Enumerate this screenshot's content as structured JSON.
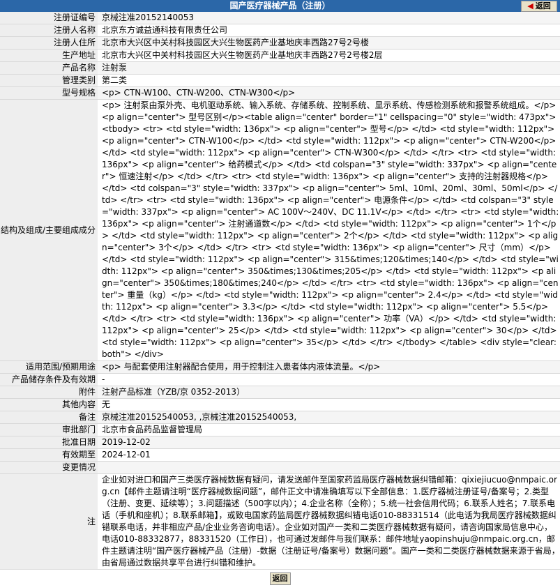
{
  "header": {
    "title": "国产医疗器械产品（注册）",
    "back_label": "返回"
  },
  "rows": [
    {
      "label": "注册证编号",
      "value": "京械注准20152140053"
    },
    {
      "label": "注册人名称",
      "value": "北京东方诚益通科技有限责任公司"
    },
    {
      "label": "注册人住所",
      "value": "北京市大兴区中关村科技园区大兴生物医药产业基地庆丰西路27号2号楼"
    },
    {
      "label": "生产地址",
      "value": "北京市大兴区中关村科技园区大兴生物医药产业基地庆丰西路27号2号楼2层"
    },
    {
      "label": "产品名称",
      "value": "注射泵"
    },
    {
      "label": "管理类别",
      "value": "第二类"
    },
    {
      "label": "型号规格",
      "value": "<p> CTN-W100、CTN-W200、CTN-W300</p>"
    },
    {
      "label": "结构及组成/主要组成成分",
      "value": "<p> 注射泵由泵外壳、电机驱动系统、输入系统、存储系统、控制系统、显示系统、传感检测系统和报警系统组成。</p> <p align=\"center\"> 型号区别</p><table align=\"center\" border=\"1\" cellspacing=\"0\" style=\"width: 473px\"> <tbody> <tr> <td style=\"width: 136px\"> <p align=\"center\"> 型号</p> </td> <td style=\"width: 112px\"> <p align=\"center\"> CTN-W100</p> </td> <td style=\"width: 112px\"> <p align=\"center\"> CTN-W200</p> </td> <td style=\"width: 112px\"> <p align=\"center\"> CTN-W300</p> </td> </tr> <tr> <td style=\"width: 136px\"> <p align=\"center\"> 给药模式</p> </td> <td colspan=\"3\" style=\"width: 337px\"> <p align=\"center\"> 恒速注射</p> </td> </tr> <tr> <td style=\"width: 136px\"> <p align=\"center\"> 支持的注射器规格</p> </td> <td colspan=\"3\" style=\"width: 337px\"> <p align=\"center\"> 5ml、10ml、20ml、30ml、50ml</p> </td> </tr> <tr> <td style=\"width: 136px\"> <p align=\"center\"> 电源条件</p> </td> <td colspan=\"3\" style=\"width: 337px\"> <p align=\"center\"> AC 100V～240V、DC 11.1V</p> </td> </tr> <tr> <td style=\"width: 136px\"> <p align=\"center\"> 注射通道数</p> </td> <td style=\"width: 112px\"> <p align=\"center\"> 1个</p> </td> <td style=\"width: 112px\"> <p align=\"center\"> 2个</p> </td> <td style=\"width: 112px\"> <p align=\"center\"> 3个</p> </td> </tr> <tr> <td style=\"width: 136px\"> <p align=\"center\"> 尺寸（mm）</p> </td> <td style=\"width: 112px\"> <p align=\"center\"> 315&times;120&times;140</p> </td> <td style=\"width: 112px\"> <p align=\"center\"> 350&times;130&times;205</p> </td> <td style=\"width: 112px\"> <p align=\"center\"> 350&times;180&times;240</p> </td> </tr> <tr> <td style=\"width: 136px\"> <p align=\"center\"> 重量（kg）</p> </td> <td style=\"width: 112px\"> <p align=\"center\"> 2.4</p> </td> <td style=\"width: 112px\"> <p align=\"center\"> 3.3</p> </td> <td style=\"width: 112px\"> <p align=\"center\"> 5.5</p> </td> </tr> <tr> <td style=\"width: 136px\"> <p align=\"center\"> 功率（VA）</p> </td> <td style=\"width: 112px\"> <p align=\"center\"> 25</p> </td> <td style=\"width: 112px\"> <p align=\"center\"> 30</p> </td> <td style=\"width: 112px\"> <p align=\"center\"> 35</p> </td> </tr> </tbody> </table> <div style=\"clear: both\"> </div>"
    },
    {
      "label": "适用范围/预期用途",
      "value": "<p> 与配套使用注射器配合使用，用于控制注入患者体内液体流量。</p>"
    },
    {
      "label": "产品储存条件及有效期",
      "value": "-"
    },
    {
      "label": "附件",
      "value": "注射产品标准（YZB/京 0352-2013）"
    },
    {
      "label": "其他内容",
      "value": "无"
    },
    {
      "label": "备注",
      "value": "京械注准20152540053, ,京械注准20152540053,"
    },
    {
      "label": "审批部门",
      "value": "北京市食品药品监督管理局"
    },
    {
      "label": "批准日期",
      "value": "2019-12-02"
    },
    {
      "label": "有效期至",
      "value": "2024-12-01"
    },
    {
      "label": "变更情况",
      "value": ""
    },
    {
      "label": "注",
      "value": "企业如对进口和国产三类医疗器械数据有疑问，请发送邮件至国家药监局医疗器械数据纠错邮箱：qixiejiucuo@nmpaic.org.cn【邮件主题请注明“医疗器械数据问题”，邮件正文中请准确填写以下全部信息：1.医疗器械注册证号/备案号；2.类型（注册、变更、延续等）；3.问题描述（500字以内）；4.企业名称（全称）；5.统一社会信用代码；6.联系人姓名；7.联系电话（手机和座机）；8.联系邮箱】，或致电国家药监局医疗器械数据纠错电话010-88331514（此电话为我局医疗器械数据纠错联系电话，并非相应产品/企业业务咨询电话）。企业如对国产一类和二类医疗器械数据有疑问，请咨询国家局信息中心，电话010-88332877，88331520（工作日），也可通过发邮件与我们联系：邮件地址yaopinshuju@nmpaic.org.cn，邮件主题请注明“国产医疗器械产品（注册）-数据（注册证号/备案号）数据问题”。国产一类和二类医疗器械数据来源于省局，由省局通过数据共享平台进行纠错和维护。"
    }
  ],
  "footer": {
    "back_label": "返回"
  }
}
